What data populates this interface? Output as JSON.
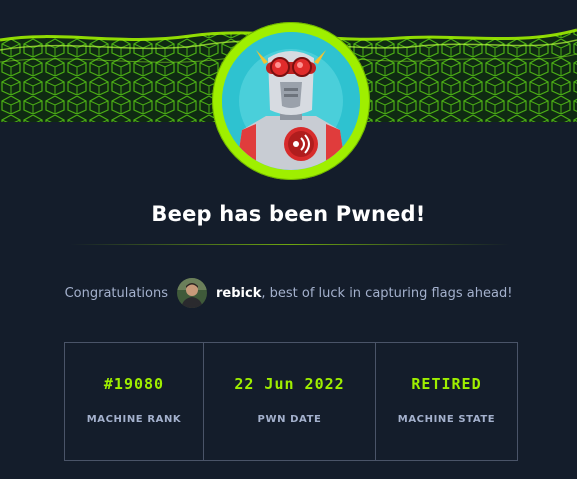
{
  "header": {
    "title": "Beep has been Pwned!"
  },
  "congrats": {
    "prefix": "Congratulations",
    "username": "rebick",
    "suffix": ", best of luck in capturing flags ahead!"
  },
  "stats": [
    {
      "value": "#19080",
      "label": "MACHINE RANK"
    },
    {
      "value": "22 Jun 2022",
      "label": "PWN DATE"
    },
    {
      "value": "RETIRED",
      "label": "MACHINE STATE"
    }
  ],
  "icons": {
    "machine_avatar": "robot-avatar-icon",
    "user_avatar": "user-avatar-icon"
  },
  "colors": {
    "background": "#141d2b",
    "accent": "#9fef00",
    "muted_text": "#a4b1cd",
    "border": "#4a5468"
  }
}
